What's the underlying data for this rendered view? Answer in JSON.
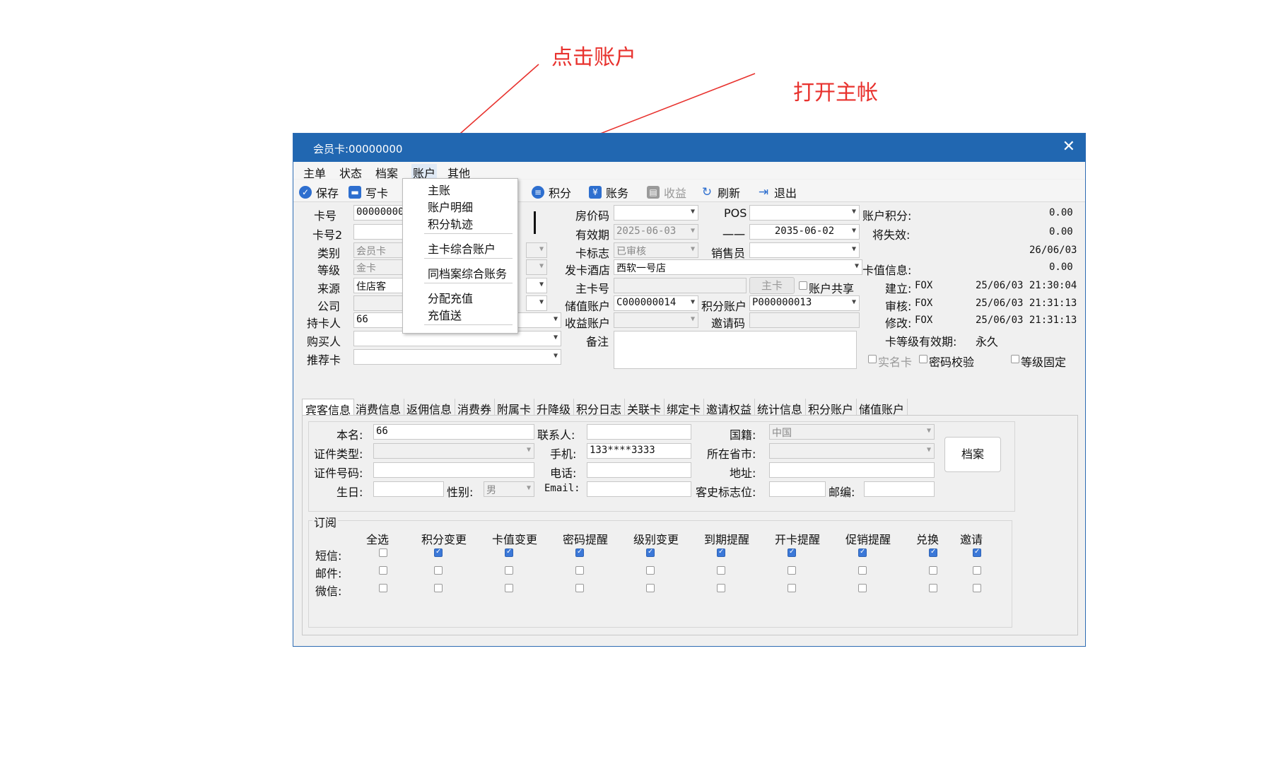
{
  "annotations": {
    "click_account": "点击账户",
    "open_main": "打开主帐"
  },
  "window": {
    "title": "会员卡:00000000",
    "close_glyph": "✕"
  },
  "menubar": [
    "主单",
    "状态",
    "档案",
    "账户",
    "其他"
  ],
  "toolbar": {
    "save": "保存",
    "write_card": "写卡",
    "points": "积分",
    "ledger": "账务",
    "revenue": "收益",
    "refresh": "刷新",
    "exit": "退出"
  },
  "dropdown": {
    "items": [
      "主账",
      "账户明细",
      "积分轨迹",
      "主卡综合账户",
      "同档案综合账务",
      "分配充值",
      "充值送"
    ]
  },
  "form": {
    "card_no_label": "卡号",
    "card_no": "00000000",
    "card_no2_label": "卡号2",
    "card_no2": "",
    "type_label": "类别",
    "type": "会员卡",
    "level_label": "等级",
    "level": "金卡",
    "source_label": "来源",
    "source": "住店客",
    "company_label": "公司",
    "company": "",
    "holder_label": "持卡人",
    "holder": "66",
    "buyer_label": "购买人",
    "buyer": "",
    "referrer_label": "推荐卡",
    "referrer": "",
    "rate_code_label": "房价码",
    "rate_code": "",
    "valid_label": "有效期",
    "valid_from": "2025-06-03",
    "dash_label": "一一",
    "valid_to": "2035-06-02",
    "card_flag_label": "卡标志",
    "card_flag": "已审核",
    "issue_hotel_label": "发卡酒店",
    "issue_hotel": "西软一号店",
    "main_card_label": "主卡号",
    "main_card": "",
    "main_card_btn": "主卡",
    "share_label": "账户共享",
    "stored_acct_label": "储值账户",
    "stored_acct": "C000000014",
    "revenue_acct_label": "收益账户",
    "revenue_acct": "",
    "remark_label": "备注",
    "remark": "",
    "pos_label": "POS",
    "pos": "",
    "sales_label": "销售员",
    "sales": "",
    "points_acct_label": "积分账户",
    "points_acct": "P000000013",
    "invite_label": "邀请码",
    "invite": ""
  },
  "info": {
    "acct_points_label": "账户积分:",
    "acct_points": "0.00",
    "expiring_label": "将失效:",
    "expiring": "0.00",
    "date_val": "26/06/03",
    "card_value_label": "卡值信息:",
    "card_value": "0.00",
    "created_label": "建立:",
    "created_by": "FOX",
    "created_at": "25/06/03 21:30:04",
    "audited_label": "审核:",
    "audited_by": "FOX",
    "audited_at": "25/06/03 21:31:13",
    "modified_label": "修改:",
    "modified_by": "FOX",
    "modified_at": "25/06/03 21:31:13",
    "level_valid_label": "卡等级有效期:",
    "level_valid": "永久",
    "realname_label": "实名卡",
    "pwd_check_label": "密码校验",
    "level_fixed_label": "等级固定"
  },
  "tabs": [
    "宾客信息",
    "消费信息",
    "返佣信息",
    "消费券",
    "附属卡",
    "升降级",
    "积分日志",
    "关联卡",
    "绑定卡",
    "邀请权益",
    "统计信息",
    "积分账户",
    "储值账户"
  ],
  "guest": {
    "name_label": "本名:",
    "name": "66",
    "contact_label": "联系人:",
    "contact": "",
    "nation_label": "国籍:",
    "nation": "中国",
    "idtype_label": "证件类型:",
    "idtype": "",
    "mobile_label": "手机:",
    "mobile": "133****3333",
    "province_label": "所在省市:",
    "province": "",
    "idno_label": "证件号码:",
    "idno": "",
    "phone_label": "电话:",
    "phone": "",
    "address_label": "地址:",
    "address": "",
    "birthday_label": "生日:",
    "birthday": "",
    "gender_label": "性别:",
    "gender": "男",
    "email_label": "Email:",
    "email": "",
    "history_label": "客史标志位:",
    "history": "",
    "zip_label": "邮编:",
    "zip": "",
    "archive_btn": "档案"
  },
  "subscription": {
    "title": "订阅",
    "columns": [
      "全选",
      "积分变更",
      "卡值变更",
      "密码提醒",
      "级别变更",
      "到期提醒",
      "开卡提醒",
      "促销提醒",
      "兑换",
      "邀请"
    ],
    "rows": [
      {
        "label": "短信:",
        "checks": [
          false,
          true,
          true,
          true,
          true,
          true,
          true,
          true,
          true,
          true
        ]
      },
      {
        "label": "邮件:",
        "checks": [
          false,
          false,
          false,
          false,
          false,
          false,
          false,
          false,
          false,
          false
        ]
      },
      {
        "label": "微信:",
        "checks": [
          false,
          false,
          false,
          false,
          false,
          false,
          false,
          false,
          false,
          false
        ]
      }
    ]
  }
}
